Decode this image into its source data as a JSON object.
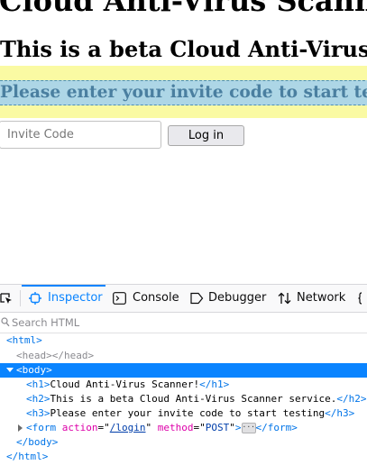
{
  "page": {
    "h1": "Cloud Anti-Virus Scanner!",
    "h2": "This is a beta Cloud Anti-Virus Scanner service.",
    "h3": "Please enter your invite code to start testing",
    "invite_placeholder": "Invite Code",
    "login_label": "Log in"
  },
  "devtools": {
    "tabs": [
      {
        "label": "Inspector",
        "active": true
      },
      {
        "label": "Console"
      },
      {
        "label": "Debugger"
      },
      {
        "label": "Network"
      }
    ],
    "search_placeholder": "Search HTML",
    "tree": {
      "html_open": "html",
      "head": "head",
      "body": "body",
      "h1": {
        "tag": "h1",
        "text": "Cloud Anti-Virus Scanner!"
      },
      "h2": {
        "tag": "h2",
        "text": "This is a beta Cloud Anti-Virus Scanner service."
      },
      "h3": {
        "tag": "h3",
        "text": "Please enter your invite code to start testing"
      },
      "form": {
        "tag": "form",
        "action_attr": "action",
        "action_value": "/login",
        "method_attr": "method",
        "method_value": "POST",
        "ellipsis": "···"
      }
    }
  },
  "colors": {
    "accent": "#0a84ff",
    "highlight_margin": "#fafaa3",
    "highlight_content": "#add6e6"
  }
}
